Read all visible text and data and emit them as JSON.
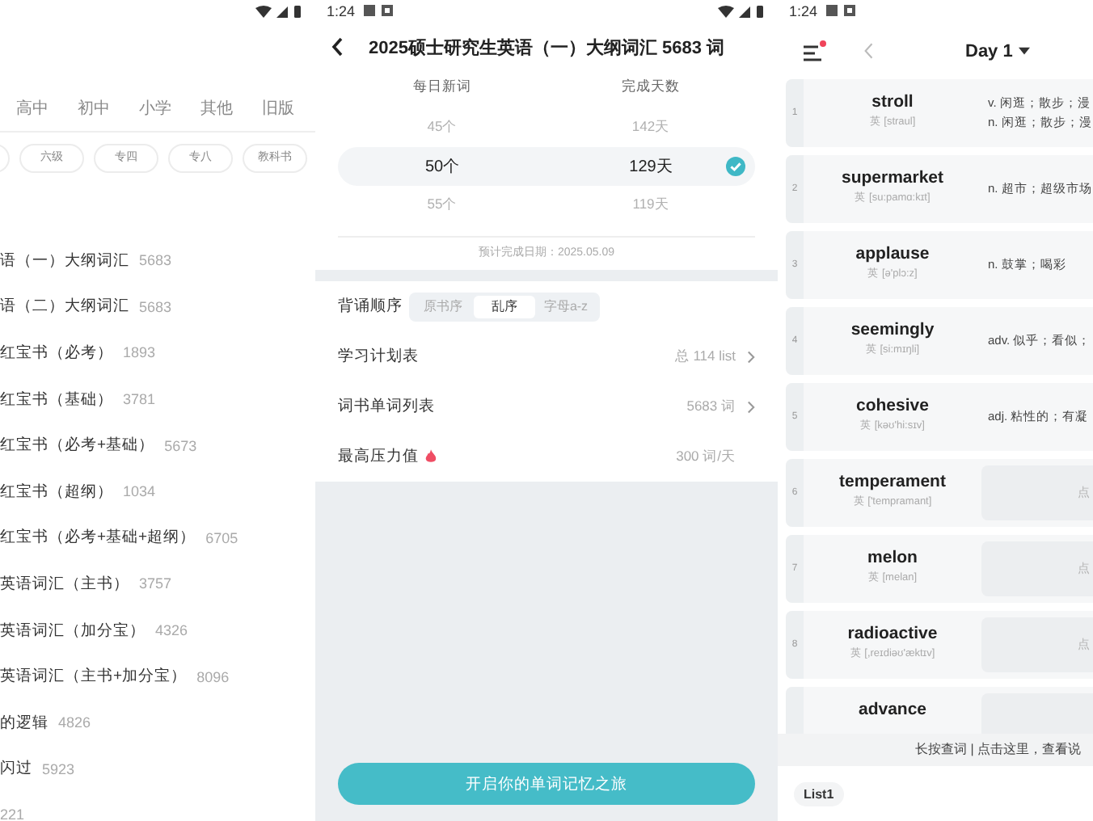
{
  "book_list": {
    "tabs": [
      {
        "label": "高中"
      },
      {
        "label": "初中"
      },
      {
        "label": "小学"
      },
      {
        "label": "其他"
      },
      {
        "label": "旧版"
      }
    ],
    "chips": [
      "六级",
      "专四",
      "专八",
      "教科书"
    ],
    "books": [
      {
        "title": "语（一）大纲词汇",
        "count": "5683"
      },
      {
        "title": "语（二）大纲词汇",
        "count": "5683"
      },
      {
        "title": "红宝书（必考）",
        "count": "1893"
      },
      {
        "title": "红宝书（基础）",
        "count": "3781"
      },
      {
        "title": "红宝书（必考+基础）",
        "count": "5673"
      },
      {
        "title": "红宝书（超纲）",
        "count": "1034"
      },
      {
        "title": "红宝书（必考+基础+超纲）",
        "count": "6705"
      },
      {
        "title": "英语词汇（主书）",
        "count": "3757"
      },
      {
        "title": "英语词汇（加分宝）",
        "count": "4326"
      },
      {
        "title": "英语词汇（主书+加分宝）",
        "count": "8096"
      },
      {
        "title": "的逻辑",
        "count": "4826"
      },
      {
        "title": "闪过",
        "count": "5923"
      },
      {
        "count": "221"
      }
    ]
  },
  "plan": {
    "status_time": "1:24",
    "title": "2025硕士研究生英语（一）大纲词汇 5683 词",
    "columns": [
      "每日新词",
      "完成天数"
    ],
    "options": [
      {
        "daily": "45个",
        "days": "142天",
        "selected": false
      },
      {
        "daily": "50个",
        "days": "129天",
        "selected": true
      },
      {
        "daily": "55个",
        "days": "119天",
        "selected": false
      }
    ],
    "finish_date": "预计完成日期：2025.05.09",
    "order": {
      "label": "背诵顺序",
      "options": [
        {
          "label": "原书序",
          "selected": false
        },
        {
          "label": "乱序",
          "selected": true
        },
        {
          "label": "字母a-z",
          "selected": false
        }
      ]
    },
    "settings": [
      {
        "label": "学习计划表",
        "value": "总 114 list",
        "kind": "link"
      },
      {
        "label": "词书单词列表",
        "value": "5683 词",
        "kind": "link"
      },
      {
        "label": "最高压力值",
        "value": "300 词/天",
        "kind": "flame"
      }
    ],
    "start_button": "开启你的单词记忆之旅"
  },
  "words": {
    "status_time": "1:24",
    "menu_badge": true,
    "day": "Day 1",
    "items": [
      {
        "index": "1",
        "word": "stroll",
        "phonetic": "英 [straul]",
        "meanings": [
          "v. 闲逛；散步；漫",
          "n. 闲逛；散步；漫"
        ],
        "hidden": false
      },
      {
        "index": "2",
        "word": "supermarket",
        "phonetic": "英 [su:pamɑ:kɪt]",
        "meanings": [
          "n. 超市；超级市场"
        ],
        "hidden": false
      },
      {
        "index": "3",
        "word": "applause",
        "phonetic": "英 [ə'plɔ:z]",
        "meanings": [
          "n. 鼓掌；喝彩"
        ],
        "hidden": false
      },
      {
        "index": "4",
        "word": "seemingly",
        "phonetic": "英 [si:mɪŋli]",
        "meanings": [
          "adv. 似乎；看似；"
        ],
        "hidden": false
      },
      {
        "index": "5",
        "word": "cohesive",
        "phonetic": "英 [kəʊ'hi:sɪv]",
        "meanings": [
          "adj. 粘性的；有凝"
        ],
        "hidden": false
      },
      {
        "index": "6",
        "word": "temperament",
        "phonetic": "英 ['tempramant]",
        "meanings": [
          "点"
        ],
        "hidden": true
      },
      {
        "index": "7",
        "word": "melon",
        "phonetic": "英 [melan]",
        "meanings": [
          "点"
        ],
        "hidden": true
      },
      {
        "index": "8",
        "word": "radioactive",
        "phonetic": "英 [,reɪdiəʊ'æktɪv]",
        "meanings": [
          "点"
        ],
        "hidden": true
      },
      {
        "word": "advance",
        "hidden": true
      }
    ],
    "hint": "长按查词 | 点击这里，查看说",
    "list_tab": "List1"
  }
}
